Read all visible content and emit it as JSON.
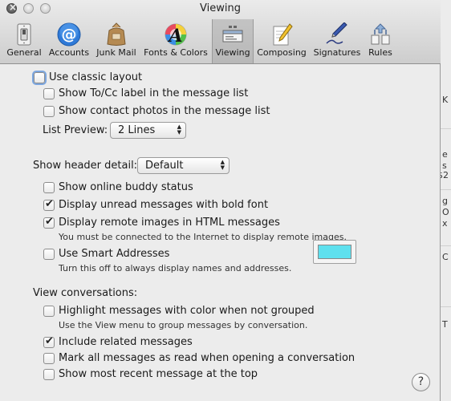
{
  "window": {
    "title": "Viewing"
  },
  "toolbar": {
    "items": [
      {
        "label": "General",
        "icon": "light-switch-icon"
      },
      {
        "label": "Accounts",
        "icon": "at-sign-icon"
      },
      {
        "label": "Junk Mail",
        "icon": "trash-bag-icon"
      },
      {
        "label": "Fonts & Colors",
        "icon": "color-letter-icon"
      },
      {
        "label": "Viewing",
        "icon": "viewing-icon",
        "selected": true
      },
      {
        "label": "Composing",
        "icon": "pencil-paper-icon"
      },
      {
        "label": "Signatures",
        "icon": "fountain-pen-icon"
      },
      {
        "label": "Rules",
        "icon": "rules-arrows-icon"
      }
    ]
  },
  "layout_section": {
    "use_classic_layout": {
      "label": "Use classic layout",
      "checked": false
    },
    "show_tocc": {
      "label": "Show To/Cc label in the message list",
      "checked": false
    },
    "show_contact_photos": {
      "label": "Show contact photos in the message list",
      "checked": false
    },
    "list_preview": {
      "label": "List Preview:",
      "value": "2 Lines"
    }
  },
  "header_section": {
    "show_header_detail": {
      "label": "Show header detail:",
      "value": "Default"
    },
    "show_buddy_status": {
      "label": "Show online buddy status",
      "checked": false
    },
    "bold_unread": {
      "label": "Display unread messages with bold font",
      "checked": true
    },
    "remote_images": {
      "label": "Display remote images in HTML messages",
      "checked": true,
      "note": "You must be connected to the Internet to display remote images."
    },
    "smart_addresses": {
      "label": "Use Smart Addresses",
      "checked": false,
      "note": "Turn this off to always display names and addresses."
    }
  },
  "conversations": {
    "heading": "View conversations:",
    "highlight": {
      "label": "Highlight messages with color when not grouped",
      "checked": false,
      "note": "Use the View menu to group messages by conversation.",
      "color": "#5ee0ee"
    },
    "include_related": {
      "label": "Include related messages",
      "checked": true
    },
    "mark_all_read": {
      "label": "Mark all messages as read when opening a conversation",
      "checked": false
    },
    "recent_top": {
      "label": "Show most recent message at the top",
      "checked": false
    }
  },
  "help": {
    "label": "?"
  },
  "background_window": {
    "fragments": [
      "K",
      "e",
      "s",
      "$2",
      "g",
      "O",
      "x",
      "C",
      "T"
    ]
  }
}
